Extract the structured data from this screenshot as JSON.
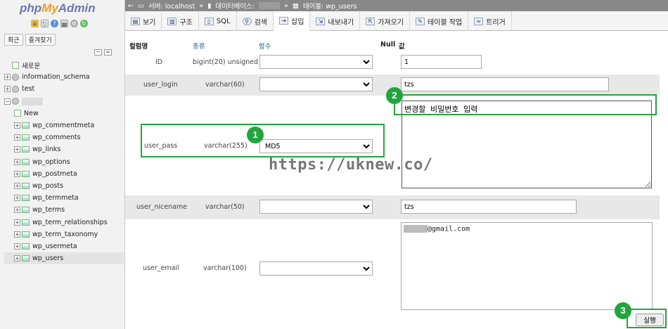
{
  "logo": {
    "php": "php",
    "my": "My",
    "admin": "Admin"
  },
  "sidebar": {
    "tabs": [
      "최근",
      "즐겨찾기"
    ],
    "tree": {
      "new_root": "새로운",
      "databases": [
        "information_schema",
        "test"
      ],
      "selected_new": "New",
      "tables": [
        "wp_commentmeta",
        "wp_comments",
        "wp_links",
        "wp_options",
        "wp_postmeta",
        "wp_posts",
        "wp_termmeta",
        "wp_terms",
        "wp_term_relationships",
        "wp_term_taxonomy",
        "wp_usermeta",
        "wp_users"
      ]
    }
  },
  "breadcrumb": {
    "server": "서버: localhost",
    "database": "데이터베이스:",
    "table": "테이블: wp_users",
    "sep": "»"
  },
  "menu": {
    "browse": "보기",
    "structure": "구조",
    "sql": "SQL",
    "search": "검색",
    "insert": "삽입",
    "export": "내보내기",
    "import": "가져오기",
    "operations": "테이블 작업",
    "triggers": "트리거"
  },
  "form": {
    "headers": {
      "column": "컬럼명",
      "type": "종류",
      "function": "함수",
      "null": "Null",
      "value": "값"
    },
    "rows": [
      {
        "column": "ID",
        "type": "bigint(20) unsigned",
        "function": "",
        "value": "1"
      },
      {
        "column": "user_login",
        "type": "varchar(60)",
        "function": "",
        "value": "tzs"
      },
      {
        "column": "user_pass",
        "type": "varchar(255)",
        "function": "MD5",
        "value": "변경할 비밀번호 입력"
      },
      {
        "column": "user_nicename",
        "type": "varchar(50)",
        "function": "",
        "value": "tzs"
      },
      {
        "column": "user_email",
        "type": "varchar(100)",
        "function": "",
        "value": "@gmail.com"
      }
    ]
  },
  "annotations": {
    "badge1": "1",
    "badge2": "2",
    "badge3": "3"
  },
  "watermark": "https://uknew.co/",
  "go_button": "실행",
  "colors": {
    "highlight": "#23a43f",
    "sidebar_bg": "#f2f2f2",
    "breadcrumb_bg": "#888888",
    "row_alt": "#e8e8e8"
  }
}
